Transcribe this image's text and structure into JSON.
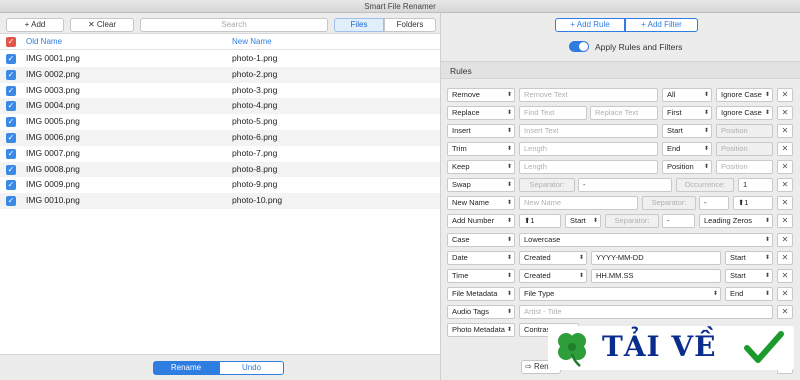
{
  "window": {
    "title": "Smart File Renamer"
  },
  "toolbar": {
    "add_label": "+ Add",
    "clear_label": "Clear",
    "search_placeholder": "Search",
    "files_label": "Files",
    "folders_label": "Folders"
  },
  "file_list": {
    "columns": {
      "old": "Old Name",
      "new": "New Name"
    },
    "rows": [
      {
        "old": "IMG 0001.png",
        "new": "photo-1.png"
      },
      {
        "old": "IMG 0002.png",
        "new": "photo-2.png"
      },
      {
        "old": "IMG 0003.png",
        "new": "photo-3.png"
      },
      {
        "old": "IMG 0004.png",
        "new": "photo-4.png"
      },
      {
        "old": "IMG 0005.png",
        "new": "photo-5.png"
      },
      {
        "old": "IMG 0006.png",
        "new": "photo-6.png"
      },
      {
        "old": "IMG 0007.png",
        "new": "photo-7.png"
      },
      {
        "old": "IMG 0008.png",
        "new": "photo-8.png"
      },
      {
        "old": "IMG 0009.png",
        "new": "photo-9.png"
      },
      {
        "old": "IMG 0010.png",
        "new": "photo-10.png"
      }
    ]
  },
  "bottom": {
    "rename_label": "Rename",
    "undo_label": "Undo",
    "rename_partial": "Ren"
  },
  "right_top": {
    "add_rule_label": "+ Add Rule",
    "add_filter_label": "+ Add Filter",
    "apply_toggle_label": "Apply Rules and Filters"
  },
  "rules": {
    "title": "Rules",
    "remove": {
      "type": "Remove",
      "text_placeholder": "Remove Text",
      "scope": "All",
      "case": "Ignore Case"
    },
    "replace": {
      "type": "Replace",
      "find_placeholder": "Find Text",
      "replace_placeholder": "Replace Text",
      "scope": "First",
      "case": "Ignore Case"
    },
    "insert": {
      "type": "Insert",
      "text_placeholder": "Insert Text",
      "where": "Start",
      "position_placeholder": "Position"
    },
    "trim": {
      "type": "Trim",
      "length_placeholder": "Length",
      "where": "End",
      "position_placeholder": "Position"
    },
    "keep": {
      "type": "Keep",
      "length_placeholder": "Length",
      "where": "Position",
      "position_placeholder": "Position"
    },
    "swap": {
      "type": "Swap",
      "separator_label": "Separator:",
      "separator_value": "-",
      "occurrence_label": "Occurrence:",
      "occurrence_value": "1"
    },
    "new_name": {
      "type": "New Name",
      "name_placeholder": "New Name",
      "separator_label": "Separator:",
      "separator_value": "-",
      "start_value": "1"
    },
    "add_number": {
      "type": "Add Number",
      "start_value": "1",
      "where": "Start",
      "separator_label": "Separator:",
      "separator_value": "-",
      "padding": "Leading Zeros"
    },
    "case": {
      "type": "Case",
      "value": "Lowercase"
    },
    "date": {
      "type": "Date",
      "source": "Created",
      "format": "YYYY-MM-DD",
      "where": "Start"
    },
    "time": {
      "type": "Time",
      "source": "Created",
      "format": "HH.MM.SS",
      "where": "Start"
    },
    "file_metadata": {
      "type": "File Metadata",
      "field": "File Type",
      "where": "End"
    },
    "audio_tags": {
      "type": "Audio Tags",
      "pattern": "Artist - Title"
    },
    "photo_metadata": {
      "type": "Photo Metadata",
      "field": "Contras"
    }
  },
  "watermark": {
    "text": "TẢI VỀ"
  },
  "colors": {
    "accent": "#2f7de1",
    "checkbox": "#3b89e6",
    "header_checkbox": "#e2564a"
  },
  "icons": {
    "checkbox": "✓",
    "close": "✕",
    "stepper": "⬆",
    "arrows": "⬍"
  }
}
